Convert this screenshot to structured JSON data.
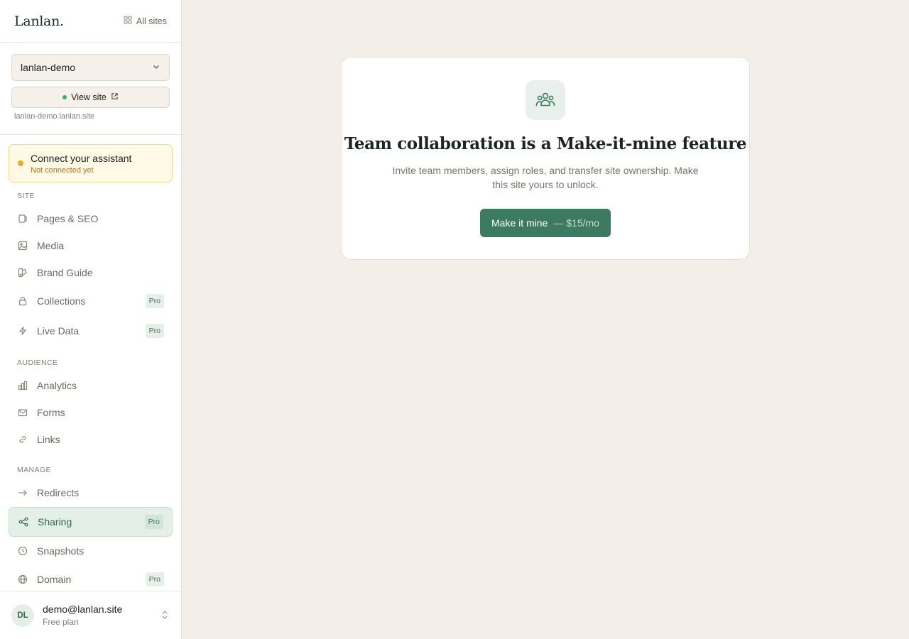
{
  "brand": {
    "logo": "Lanlan.",
    "all_sites": "All sites"
  },
  "site": {
    "selected": "lanlan-demo",
    "view_site": "View site",
    "url": "lanlan-demo.lanlan.site"
  },
  "assistant": {
    "title": "Connect your assistant",
    "status": "Not connected yet"
  },
  "sections": {
    "site": "SITE",
    "audience": "AUDIENCE",
    "manage": "MANAGE"
  },
  "nav": {
    "pages": {
      "label": "Pages & SEO",
      "icon": "page-icon"
    },
    "media": {
      "label": "Media",
      "icon": "image-icon"
    },
    "brand": {
      "label": "Brand Guide",
      "icon": "palette-icon"
    },
    "collections": {
      "label": "Collections",
      "icon": "lock-icon",
      "badge": "Pro"
    },
    "live_data": {
      "label": "Live Data",
      "icon": "lightning-icon",
      "badge": "Pro"
    },
    "analytics": {
      "label": "Analytics",
      "icon": "bar-chart-icon"
    },
    "forms": {
      "label": "Forms",
      "icon": "mail-icon"
    },
    "links": {
      "label": "Links",
      "icon": "link-icon"
    },
    "redirects": {
      "label": "Redirects",
      "icon": "arrow-right-icon"
    },
    "sharing": {
      "label": "Sharing",
      "icon": "share-icon",
      "badge": "Pro"
    },
    "snapshots": {
      "label": "Snapshots",
      "icon": "clock-icon"
    },
    "domain": {
      "label": "Domain",
      "icon": "globe-icon",
      "badge": "Pro"
    }
  },
  "user": {
    "initials": "DL",
    "email": "demo@lanlan.site",
    "plan": "Free plan"
  },
  "upsell": {
    "icon": "team-icon",
    "title": "Team collaboration is a Make-it-mine feature",
    "description": "Invite team members, assign roles, and transfer site ownership. Make this site yours to unlock.",
    "cta_label": "Make it mine",
    "cta_price": "— $15/mo"
  },
  "colors": {
    "accent": "#3d7a62",
    "background": "#f3eee8",
    "warning": "#f0a81c",
    "online": "#2fb36b"
  }
}
